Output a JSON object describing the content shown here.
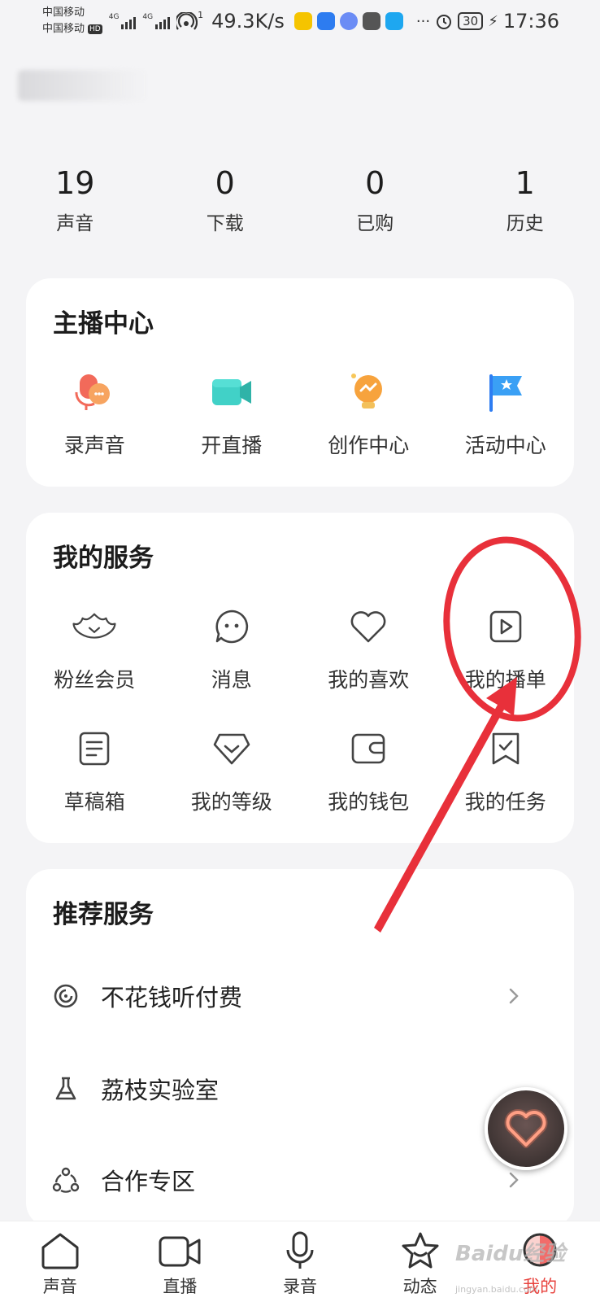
{
  "status_bar": {
    "carrier1": "中国移动",
    "carrier2": "中国移动",
    "hd": "HD",
    "network": "4G",
    "hotspot_count": "1",
    "speed": "49.3K/s",
    "more": "···",
    "battery": "30",
    "time": "17:36"
  },
  "stats": [
    {
      "value": "19",
      "label": "声音"
    },
    {
      "value": "0",
      "label": "下载"
    },
    {
      "value": "0",
      "label": "已购"
    },
    {
      "value": "1",
      "label": "历史"
    }
  ],
  "host_center": {
    "title": "主播中心",
    "items": [
      {
        "label": "录声音",
        "icon": "record-voice-icon"
      },
      {
        "label": "开直播",
        "icon": "live-camera-icon"
      },
      {
        "label": "创作中心",
        "icon": "creation-bulb-icon"
      },
      {
        "label": "活动中心",
        "icon": "activity-flag-icon"
      }
    ]
  },
  "my_services": {
    "title": "我的服务",
    "items": [
      {
        "label": "粉丝会员",
        "icon": "fan-wings-icon"
      },
      {
        "label": "消息",
        "icon": "message-bubble-icon"
      },
      {
        "label": "我的喜欢",
        "icon": "heart-icon"
      },
      {
        "label": "我的播单",
        "icon": "playlist-play-icon"
      },
      {
        "label": "草稿箱",
        "icon": "draft-doc-icon"
      },
      {
        "label": "我的等级",
        "icon": "level-diamond-icon"
      },
      {
        "label": "我的钱包",
        "icon": "wallet-icon"
      },
      {
        "label": "我的任务",
        "icon": "task-bookmark-icon"
      }
    ]
  },
  "recommended": {
    "title": "推荐服务",
    "items": [
      {
        "label": "不花钱听付费",
        "icon": "disc-icon"
      },
      {
        "label": "荔枝实验室",
        "icon": "flask-icon"
      },
      {
        "label": "合作专区",
        "icon": "cooperation-icon"
      }
    ]
  },
  "tabbar": [
    {
      "label": "声音",
      "icon": "home-icon",
      "active": false
    },
    {
      "label": "直播",
      "icon": "live-camera-tab-icon",
      "active": false
    },
    {
      "label": "录音",
      "icon": "microphone-icon",
      "active": false
    },
    {
      "label": "动态",
      "icon": "star-icon",
      "active": false
    },
    {
      "label": "我的",
      "icon": "profile-avatar-icon",
      "active": true
    }
  ],
  "watermark": {
    "brand": "Baidu经验",
    "url": "jingyan.baidu.com"
  },
  "colors": {
    "accent": "#e8423d",
    "annotation_red": "#e8303a",
    "background": "#f4f4f6",
    "card": "#ffffff"
  }
}
